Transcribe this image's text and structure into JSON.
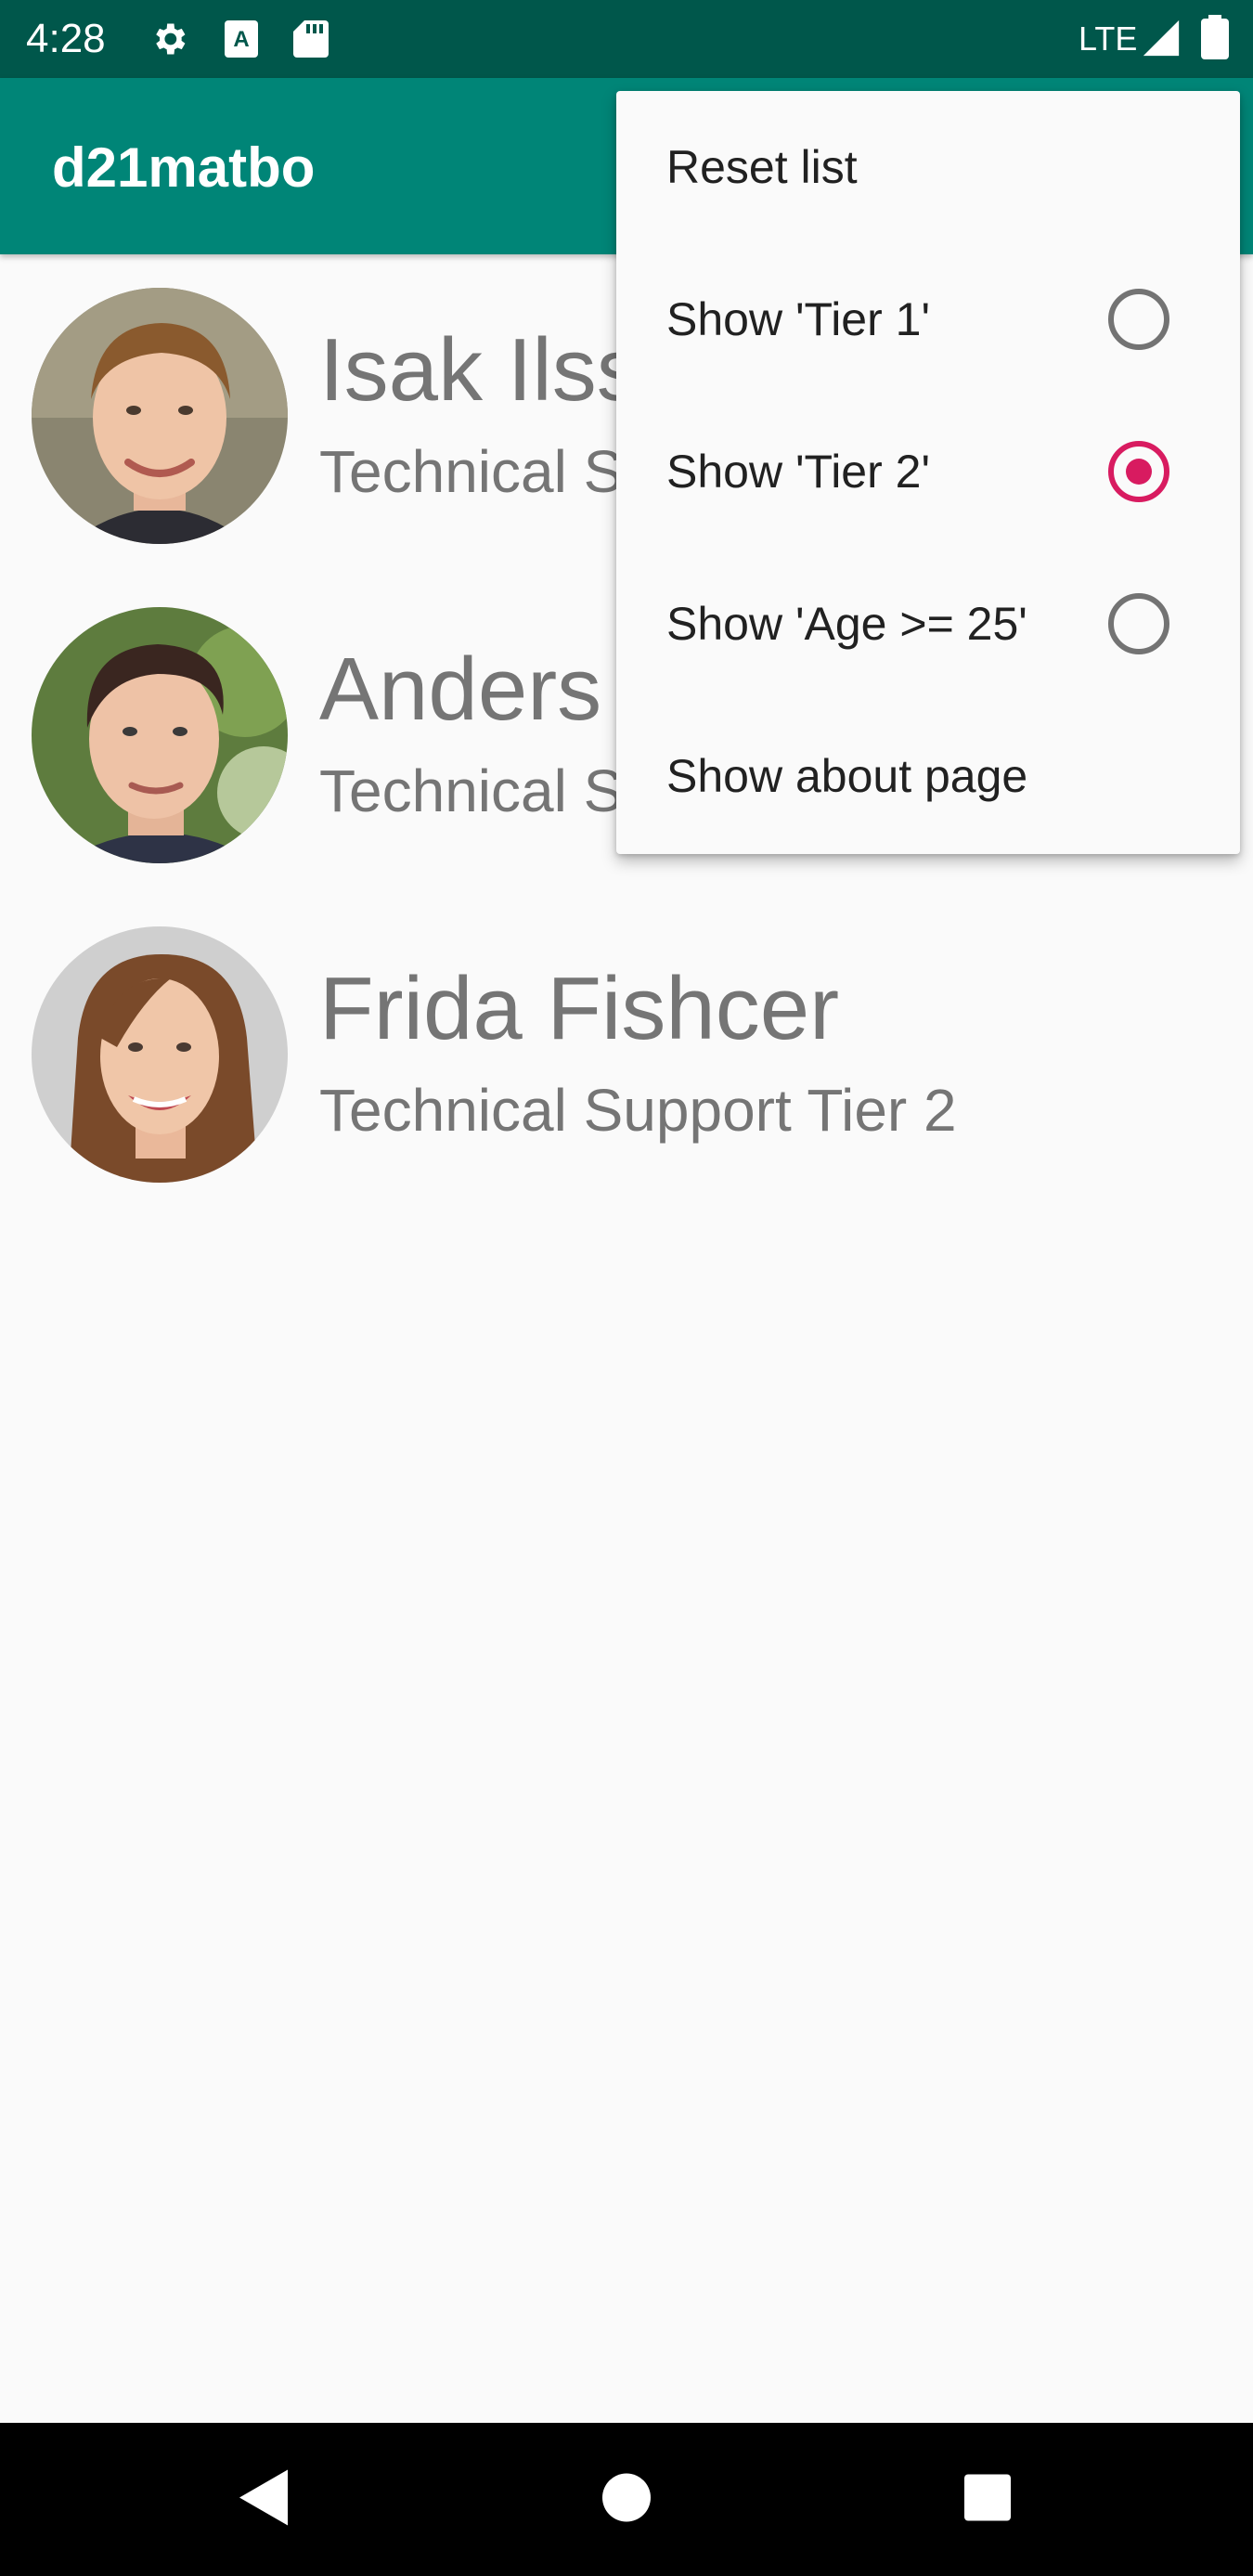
{
  "status_bar": {
    "time": "4:28",
    "icons": [
      "gear-icon",
      "accessibility-a-icon",
      "sd-card-icon",
      "signal-icon",
      "battery-icon"
    ],
    "network": "LTE",
    "background": "#00574b"
  },
  "app_bar": {
    "title": "d21matbo",
    "background": "#008577"
  },
  "list": {
    "items": [
      {
        "name": "Isak Ilsson",
        "role": "Technical Support Tier 1"
      },
      {
        "name": "Anders Andersson",
        "role": "Technical Support Tier 1"
      },
      {
        "name": "Frida Fishcer",
        "role": "Technical Support Tier 2"
      }
    ]
  },
  "overflow_menu": {
    "items": [
      {
        "label": "Reset list"
      },
      {
        "label": "Show 'Tier 1'",
        "radio": true,
        "checked": false
      },
      {
        "label": "Show 'Tier 2'",
        "radio": true,
        "checked": true
      },
      {
        "label": "Show 'Age >= 25'",
        "radio": true,
        "checked": false
      },
      {
        "label": "Show about page"
      }
    ],
    "accent": "#d81b60"
  },
  "nav_bar": {
    "buttons": [
      "back-icon",
      "home-icon",
      "recents-icon"
    ]
  }
}
